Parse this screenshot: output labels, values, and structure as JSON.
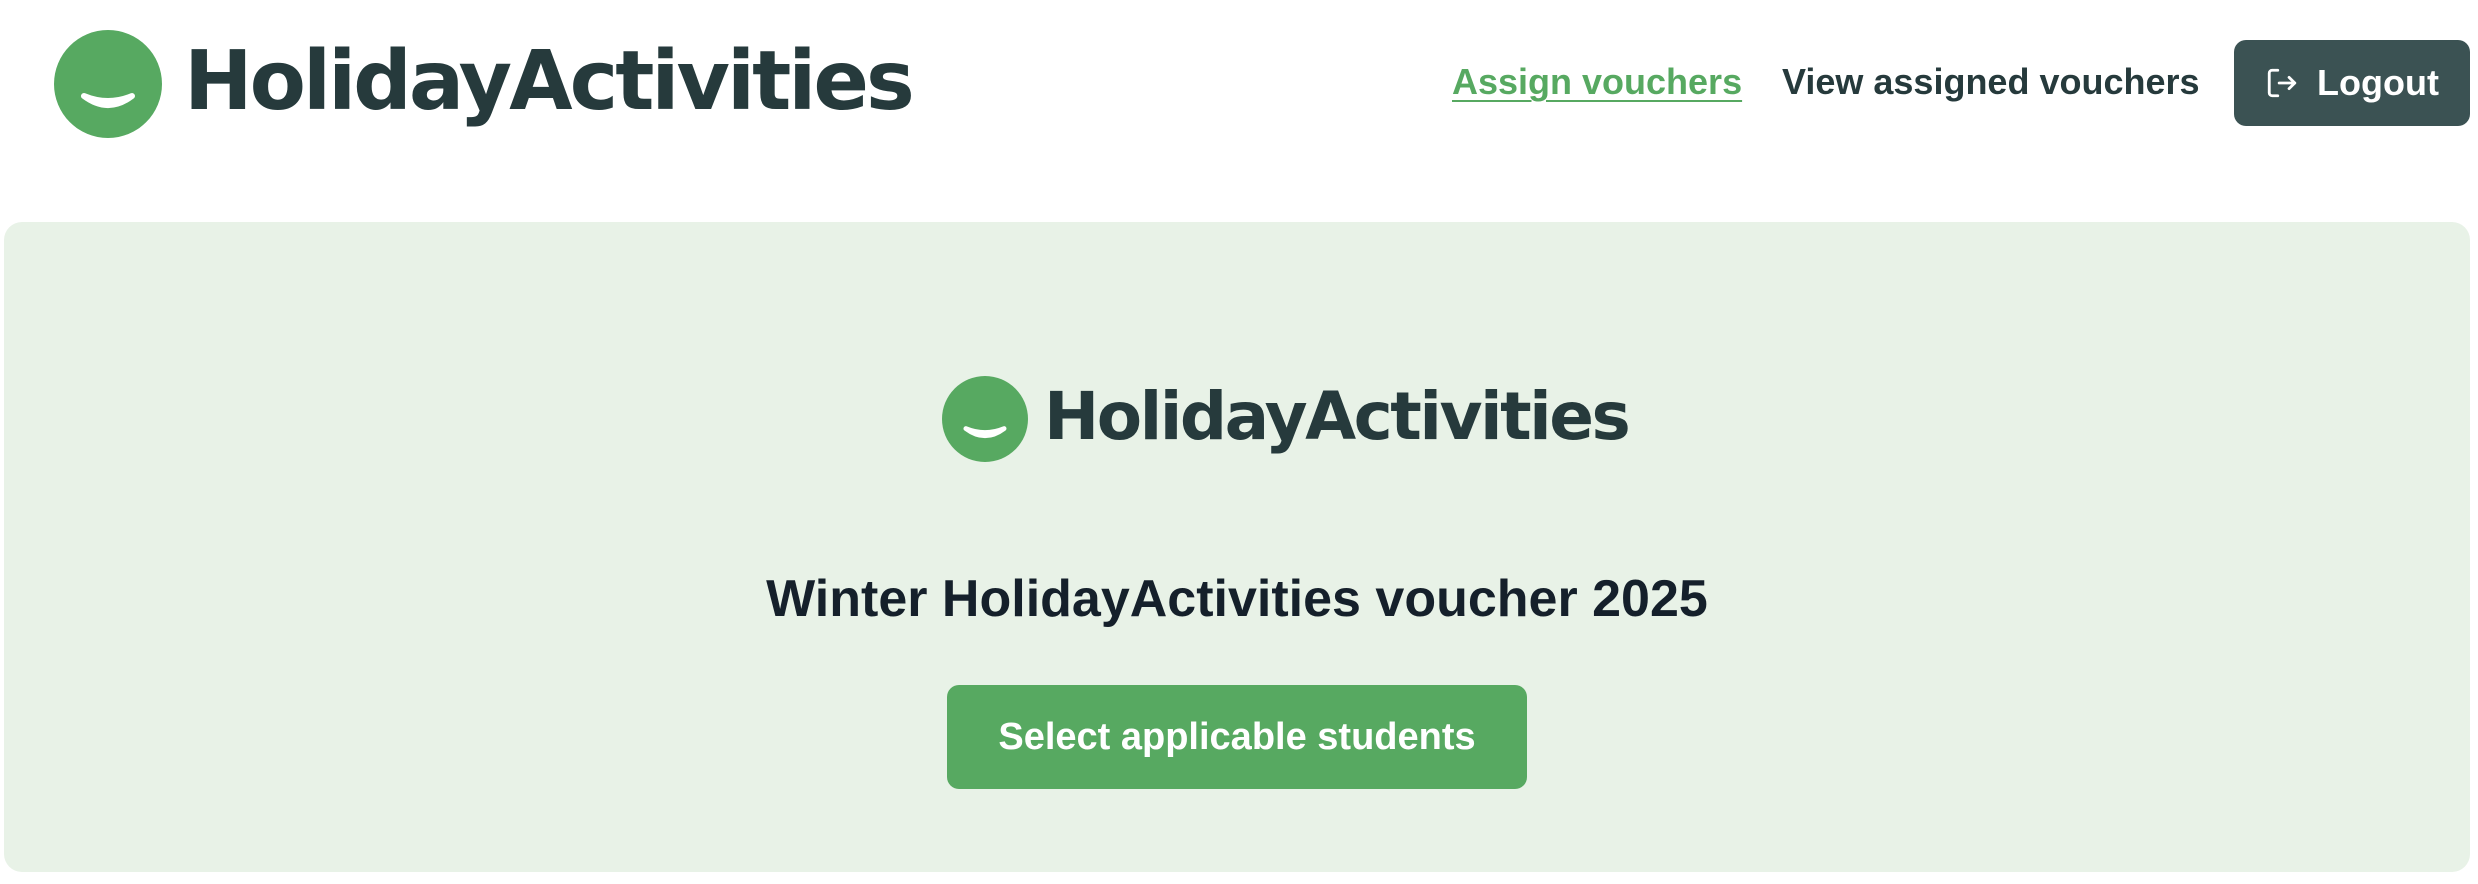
{
  "header": {
    "brand_name": "HolidayActivities",
    "nav": {
      "assign_label": "Assign vouchers",
      "view_label": "View assigned vouchers"
    },
    "logout_label": "Logout"
  },
  "main": {
    "brand_name": "HolidayActivities",
    "voucher_title": "Winter HolidayActivities voucher 2025",
    "select_button_label": "Select applicable students"
  },
  "colors": {
    "brand_green": "#57a961",
    "brand_dark": "#263a3c",
    "logout_bg": "#3b5253",
    "panel_bg": "#e8f2e7"
  },
  "icons": {
    "brand_logo": "smile-logo-icon",
    "logout": "logout-icon"
  }
}
